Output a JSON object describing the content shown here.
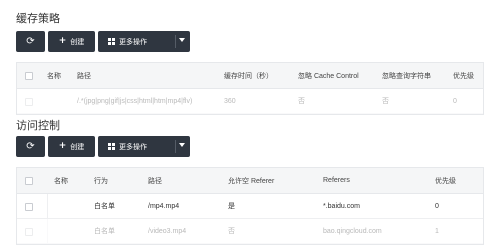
{
  "cache": {
    "title": "缓存策略",
    "toolbar": {
      "create_label": "创建",
      "more_label": "更多操作"
    },
    "headers": {
      "name": "名称",
      "path": "路径",
      "cache_time": "缓存时间（秒）",
      "ignore_cache_control": "忽略 Cache Control",
      "ignore_query": "忽略查询字符串",
      "priority": "优先级"
    },
    "rows": [
      {
        "path": "/.*(jpg|png|gif|js|css|html|htm|mp4|flv)",
        "cache_time": "360",
        "ignore_cache_control": "否",
        "ignore_query": "否",
        "priority": "0"
      }
    ]
  },
  "access": {
    "title": "访问控制",
    "toolbar": {
      "create_label": "创建",
      "more_label": "更多操作"
    },
    "headers": {
      "name": "名称",
      "action": "行为",
      "path": "路径",
      "allow_empty_referer": "允许空 Referer",
      "referers": "Referers",
      "priority": "优先级"
    },
    "rows": [
      {
        "action": "白名单",
        "path": "/mp4.mp4",
        "allow_empty": "是",
        "referers": "*.baidu.com",
        "priority": "0"
      },
      {
        "action": "白名单",
        "path": "/video3.mp4",
        "allow_empty": "否",
        "referers": "bao.qingcloud.com",
        "priority": "1"
      }
    ]
  },
  "icons": {
    "refresh": "refresh-icon",
    "plus": "plus-icon",
    "grid": "grid-icon",
    "caret": "caret-down-icon"
  },
  "colors": {
    "button_bg": "#2f3640",
    "header_bg": "#f5f6f7",
    "border": "#e6e8eb"
  }
}
